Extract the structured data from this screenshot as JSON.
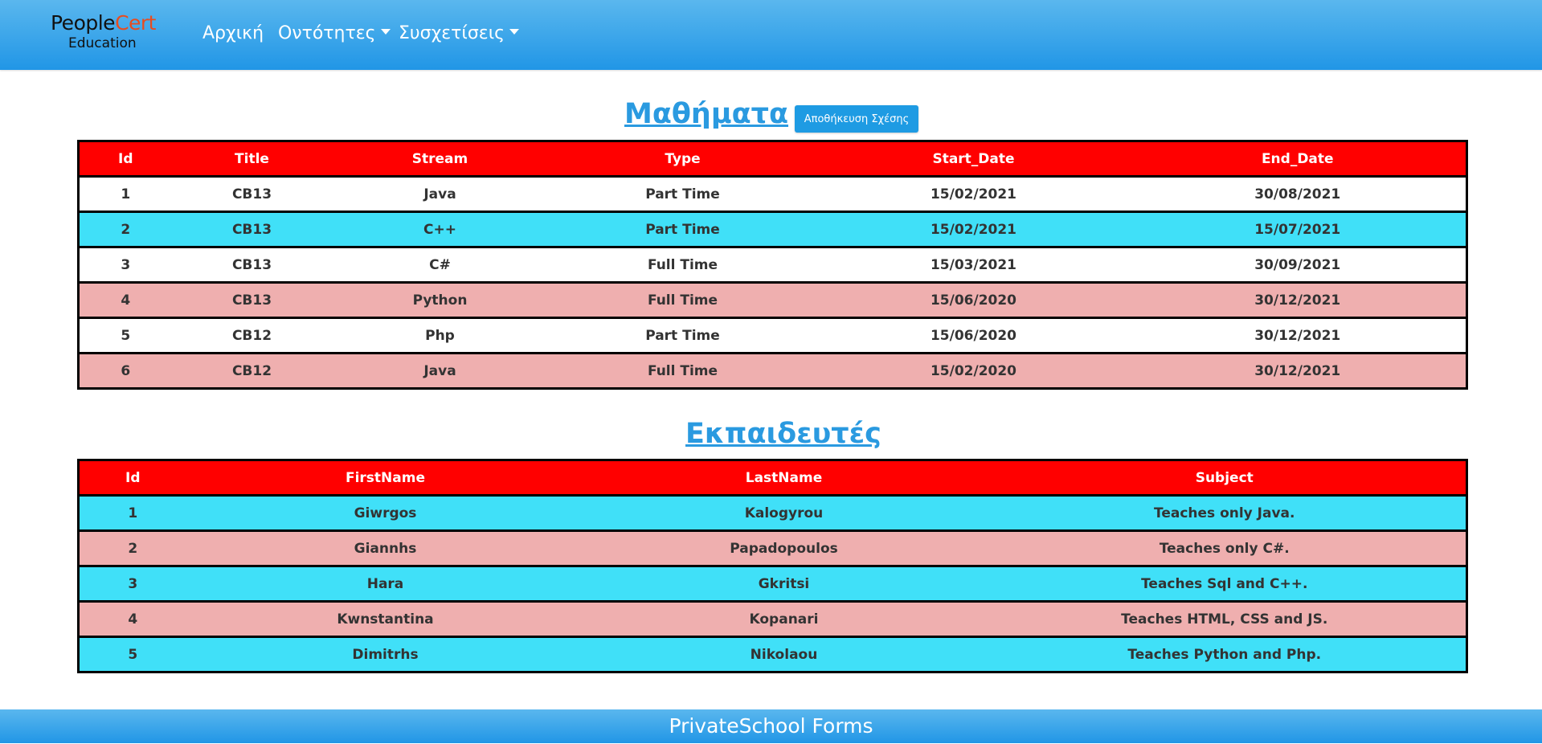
{
  "brand": {
    "name_part1": "People",
    "name_part2": "Cert",
    "subtitle": "Education"
  },
  "nav": {
    "home": "Αρχική",
    "entities": "Οντότητες",
    "relations": "Συσχετίσεις"
  },
  "courses": {
    "title": "Μαθήματα",
    "save_button": "Αποθήκευση Σχέσης",
    "headers": [
      "Id",
      "Title",
      "Stream",
      "Type",
      "Start_Date",
      "End_Date"
    ],
    "rows": [
      [
        "1",
        "CB13",
        "Java",
        "Part Time",
        "15/02/2021",
        "30/08/2021"
      ],
      [
        "2",
        "CB13",
        "C++",
        "Part Time",
        "15/02/2021",
        "15/07/2021"
      ],
      [
        "3",
        "CB13",
        "C#",
        "Full Time",
        "15/03/2021",
        "30/09/2021"
      ],
      [
        "4",
        "CB13",
        "Python",
        "Full Time",
        "15/06/2020",
        "30/12/2021"
      ],
      [
        "5",
        "CB12",
        "Php",
        "Part Time",
        "15/06/2020",
        "30/12/2021"
      ],
      [
        "6",
        "CB12",
        "Java",
        "Full Time",
        "15/02/2020",
        "30/12/2021"
      ]
    ],
    "row_colors": [
      "white",
      "cyan",
      "white",
      "pink",
      "white",
      "pink"
    ]
  },
  "trainers": {
    "title": "Εκπαιδευτές",
    "headers": [
      "Id",
      "FirstName",
      "LastName",
      "Subject"
    ],
    "rows": [
      [
        "1",
        "Giwrgos",
        "Kalogyrou",
        "Teaches only Java."
      ],
      [
        "2",
        "Giannhs",
        "Papadopoulos",
        "Teaches only C#."
      ],
      [
        "3",
        "Hara",
        "Gkritsi",
        "Teaches Sql and C++."
      ],
      [
        "4",
        "Kwnstantina",
        "Kopanari",
        "Teaches HTML, CSS and JS."
      ],
      [
        "5",
        "Dimitrhs",
        "Nikolaou",
        "Teaches Python and Php."
      ]
    ],
    "row_colors": [
      "cyan",
      "pink",
      "cyan",
      "pink",
      "cyan"
    ]
  },
  "footer": {
    "text": "PrivateSchool Forms"
  },
  "colors": {
    "header_red": "#ff0000",
    "row_cyan": "#40e0f8",
    "row_pink": "#efafaf",
    "accent_blue": "#2a9ae0",
    "nav_blue": "#2196e6"
  }
}
